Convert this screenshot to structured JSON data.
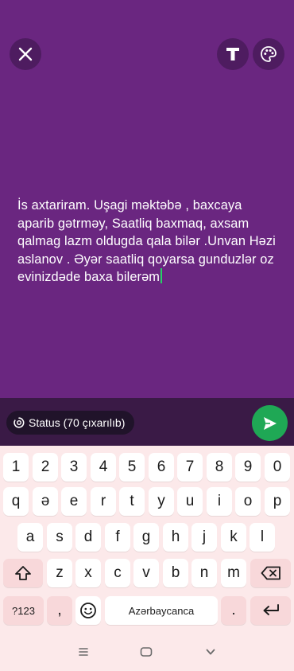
{
  "composer": {
    "background": "#6a2680",
    "status_text": "İs axtariram. Uşagi məktəbə , baxcaya aparib gətrməy, Saatliq baxmaq, axsam qalmag lazm oldugda qala bilər .Unvan Həzi aslanov . Əyər saatliq qoyarsa gunduzlər oz evinizdəde baxa bilerəm",
    "icons": [
      "close-icon",
      "text-icon",
      "palette-icon"
    ]
  },
  "status_bar": {
    "audience_label": "Status (70 çıxarılıb)",
    "send_color": "#1fa855"
  },
  "keyboard": {
    "row1": [
      "1",
      "2",
      "3",
      "4",
      "5",
      "6",
      "7",
      "8",
      "9",
      "0"
    ],
    "row2": [
      "q",
      "ə",
      "e",
      "r",
      "t",
      "y",
      "u",
      "i",
      "o",
      "p"
    ],
    "row3": [
      "a",
      "s",
      "d",
      "f",
      "g",
      "h",
      "j",
      "k",
      "l"
    ],
    "row4": [
      "z",
      "x",
      "c",
      "v",
      "b",
      "n",
      "m"
    ],
    "symbols_label": "?123",
    "comma_label": ",",
    "space_label": "Azərbaycanca",
    "period_label": "."
  },
  "navbar": {
    "icons": [
      "menu-icon",
      "home-icon",
      "back-chevron-icon"
    ]
  }
}
